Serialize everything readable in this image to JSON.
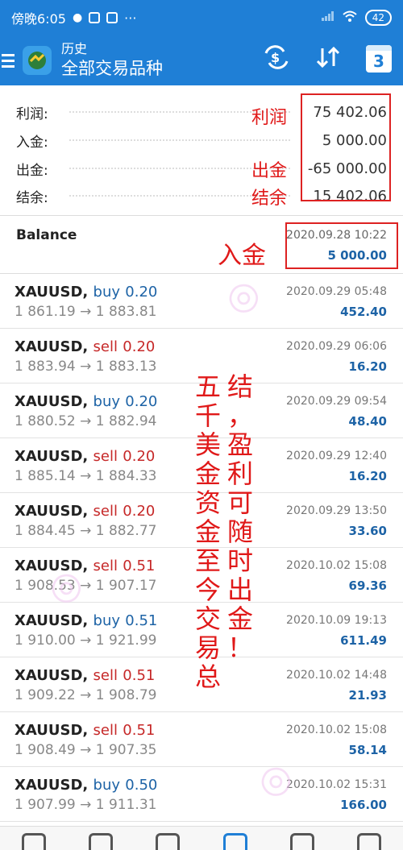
{
  "status_bar": {
    "time": "傍晚6:05",
    "dots": "···",
    "battery": "42"
  },
  "header": {
    "subtitle": "历史",
    "title": "全部交易品种"
  },
  "calendar_icon_number": "3",
  "summary": {
    "rows": [
      {
        "label": "利润:",
        "value": "75 402.06"
      },
      {
        "label": "入金:",
        "value": "5 000.00"
      },
      {
        "label": "出金:",
        "value": "-65 000.00"
      },
      {
        "label": "结余:",
        "value": "15 402.06"
      }
    ]
  },
  "annotations": {
    "profit": "利润",
    "withdraw": "出金",
    "balance": "结余",
    "deposit": "入金",
    "col1": [
      "结",
      "，",
      "盈",
      "利",
      "可",
      "随",
      "时",
      "出",
      "金",
      "！"
    ],
    "col2": [
      "五",
      "千",
      "美",
      "金",
      "资",
      "金",
      "至",
      "今",
      "交",
      "易",
      "总"
    ]
  },
  "balance_row": {
    "title": "Balance",
    "date": "2020.09.28 10:22",
    "amount": "5 000.00"
  },
  "trades": [
    {
      "symbol": "XAUUSD,",
      "side": "buy",
      "lots": "0.20",
      "prices": "1 861.19 → 1 883.81",
      "date": "2020.09.29 05:48",
      "profit": "452.40"
    },
    {
      "symbol": "XAUUSD,",
      "side": "sell",
      "lots": "0.20",
      "prices": "1 883.94 → 1 883.13",
      "date": "2020.09.29 06:06",
      "profit": "16.20"
    },
    {
      "symbol": "XAUUSD,",
      "side": "buy",
      "lots": "0.20",
      "prices": "1 880.52 → 1 882.94",
      "date": "2020.09.29 09:54",
      "profit": "48.40"
    },
    {
      "symbol": "XAUUSD,",
      "side": "sell",
      "lots": "0.20",
      "prices": "1 885.14 → 1 884.33",
      "date": "2020.09.29 12:40",
      "profit": "16.20"
    },
    {
      "symbol": "XAUUSD,",
      "side": "sell",
      "lots": "0.20",
      "prices": "1 884.45 → 1 882.77",
      "date": "2020.09.29 13:50",
      "profit": "33.60"
    },
    {
      "symbol": "XAUUSD,",
      "side": "sell",
      "lots": "0.51",
      "prices": "1 908.53 → 1 907.17",
      "date": "2020.10.02 15:08",
      "profit": "69.36"
    },
    {
      "symbol": "XAUUSD,",
      "side": "buy",
      "lots": "0.51",
      "prices": "1 910.00 → 1 921.99",
      "date": "2020.10.09 19:13",
      "profit": "611.49"
    },
    {
      "symbol": "XAUUSD,",
      "side": "sell",
      "lots": "0.51",
      "prices": "1 909.22 → 1 908.79",
      "date": "2020.10.02 14:48",
      "profit": "21.93"
    },
    {
      "symbol": "XAUUSD,",
      "side": "sell",
      "lots": "0.51",
      "prices": "1 908.49 → 1 907.35",
      "date": "2020.10.02 15:08",
      "profit": "58.14"
    },
    {
      "symbol": "XAUUSD,",
      "side": "buy",
      "lots": "0.50",
      "prices": "1 907.99 → 1 911.31",
      "date": "2020.10.02 15:31",
      "profit": "166.00"
    }
  ],
  "colors": {
    "app_bar": "#1f7fd6",
    "buy": "#1d63a6",
    "sell": "#c62828",
    "annotation_red": "#e01919"
  },
  "bottom_nav_icons": [
    "quotes-icon",
    "chart-icon",
    "trade-icon",
    "history-icon",
    "news-icon",
    "chat-icon"
  ]
}
